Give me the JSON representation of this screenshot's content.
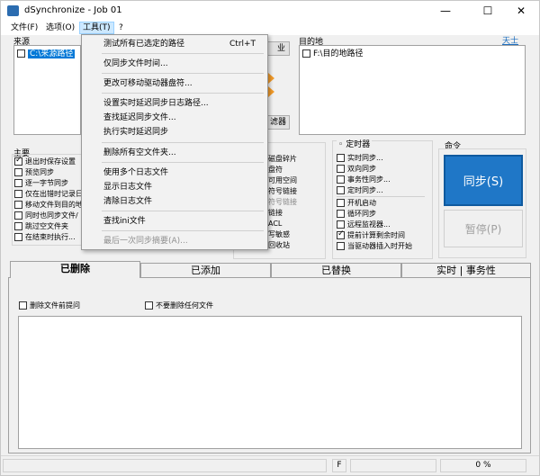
{
  "window": {
    "title": "dSynchronize - Job 01",
    "minimize": "—",
    "maximize": "☐",
    "close": "✕"
  },
  "menubar": {
    "items": [
      "文件(F)",
      "选项(O)",
      "工具(T)",
      "?"
    ]
  },
  "source": {
    "label": "来源",
    "path": "C:\\来源路径"
  },
  "destination": {
    "label": "目的地",
    "path": "F:\\目的地路径",
    "link": "天士"
  },
  "partial_buttons": {
    "copy_suffix": "业",
    "filter_suffix": "滤器"
  },
  "main_options": {
    "label": "主要",
    "items": [
      {
        "text": "退出时保存设置",
        "checked": true
      },
      {
        "text": "预览同步",
        "checked": false
      },
      {
        "text": "逐一字节同步",
        "checked": false
      },
      {
        "text": "仅在出错时记录日",
        "checked": false
      },
      {
        "text": "移动文件到目的地",
        "checked": false
      },
      {
        "text": "同时也同步文件/",
        "checked": false
      },
      {
        "text": "跳过空文件夹",
        "checked": false
      },
      {
        "text": "在结束时执行...",
        "checked": false
      }
    ]
  },
  "middle_options": {
    "items": [
      "磁盘碎片",
      "盘符",
      "可用空间",
      "符号链接",
      "符号链接",
      "链接",
      "ACL",
      "写敏感",
      "回收站"
    ]
  },
  "timer": {
    "label": "定时器",
    "items": [
      {
        "text": "实时同步...",
        "checked": false
      },
      {
        "text": "双向同步",
        "checked": false
      },
      {
        "text": "事务性同步...",
        "checked": false
      },
      {
        "text": "定时同步...",
        "checked": false
      },
      {
        "text": "开机启动",
        "checked": false
      },
      {
        "text": "循环同步",
        "checked": false
      },
      {
        "text": "远程监视器...",
        "checked": false
      },
      {
        "text": "提前计算剩余时间",
        "checked": true
      },
      {
        "text": "当驱动器插入时开始",
        "checked": false
      }
    ]
  },
  "commands": {
    "label": "命令",
    "sync": "同步(S)",
    "pause": "暂停(P)"
  },
  "tabs": [
    "已删除",
    "已添加",
    "已替换",
    "实时 | 事务性"
  ],
  "deleted_tab": {
    "prompt_before_delete": "删除文件前提问",
    "no_delete": "不要删除任何文件"
  },
  "status": {
    "drive": "F",
    "progress_text": "0 %",
    "progress": 0
  },
  "tools_menu": {
    "items": [
      {
        "label": "测试所有已选定的路径",
        "shortcut": "Ctrl+T",
        "disabled": false
      },
      {
        "label": "仅同步文件时间...",
        "shortcut": "",
        "disabled": false
      },
      {
        "label": "更改可移动驱动器盘符...",
        "shortcut": "",
        "disabled": false
      },
      {
        "label": "设置实时延迟同步日志路径...",
        "shortcut": "",
        "disabled": false
      },
      {
        "label": "查找延迟同步文件...",
        "shortcut": "",
        "disabled": false
      },
      {
        "label": "执行实时延迟同步",
        "shortcut": "",
        "disabled": false
      },
      {
        "label": "删除所有空文件夹...",
        "shortcut": "",
        "disabled": false
      },
      {
        "label": "使用多个日志文件",
        "shortcut": "",
        "disabled": false
      },
      {
        "label": "显示日志文件",
        "shortcut": "",
        "disabled": false
      },
      {
        "label": "清除日志文件",
        "shortcut": "",
        "disabled": false
      },
      {
        "label": "查找ini文件",
        "shortcut": "",
        "disabled": false
      },
      {
        "label": "最后一次同步摘要(A)...",
        "shortcut": "",
        "disabled": true
      }
    ]
  },
  "colors": {
    "accent": "#1f77c7",
    "arrow": "#f39c2a"
  }
}
